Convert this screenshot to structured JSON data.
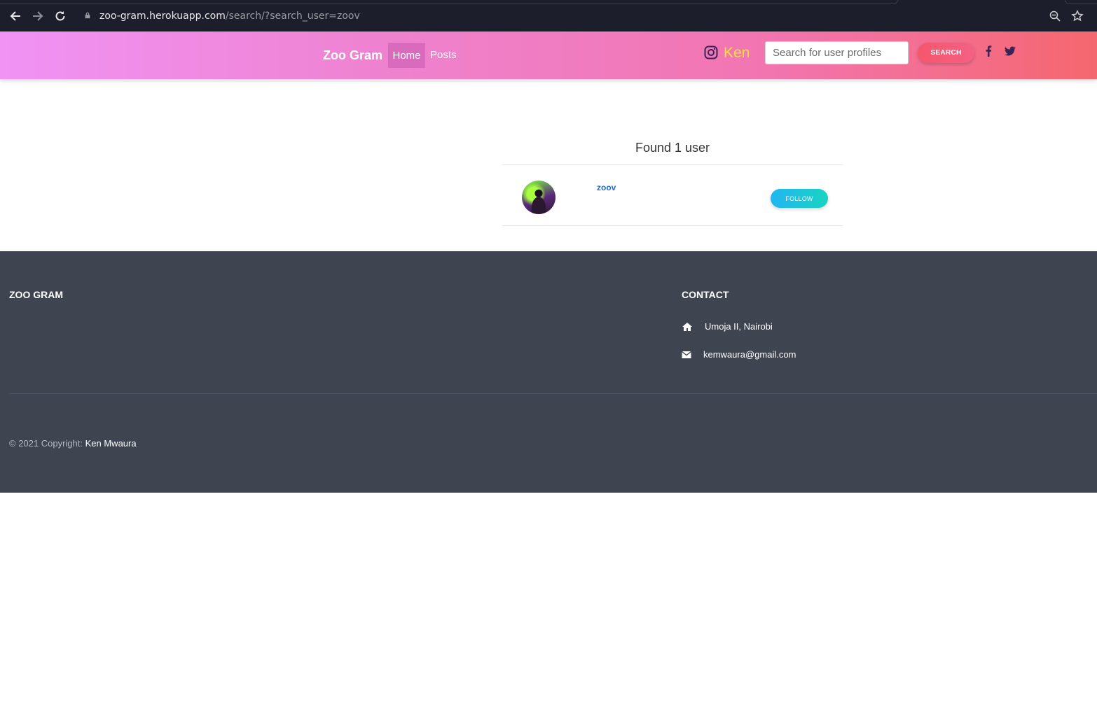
{
  "browser": {
    "url_host": "zoo-gram.herokuapp.com",
    "url_path": "/search/?search_user=zoov"
  },
  "navbar": {
    "brand": "Zoo Gram",
    "links": [
      {
        "label": "Home",
        "active": true
      },
      {
        "label": "Posts",
        "active": false
      }
    ],
    "username": "Ken",
    "search_placeholder": "Search for user profiles",
    "search_button": "SEARCH",
    "gradient": [
      "#f093f5",
      "#f5676f"
    ],
    "username_color": "#ffe23a"
  },
  "results": {
    "heading": "Found 1 user",
    "users": [
      {
        "username": "zoov",
        "follow_label": "FOLLOW"
      }
    ]
  },
  "footer": {
    "brand_title": "ZOO GRAM",
    "contact_title": "CONTACT",
    "address": "Umoja II, Nairobi",
    "email": "kemwaura@gmail.com",
    "copyright_prefix": "© 2021 Copyright:",
    "copyright_owner": "Ken Mwaura",
    "background": "#3e4551"
  }
}
